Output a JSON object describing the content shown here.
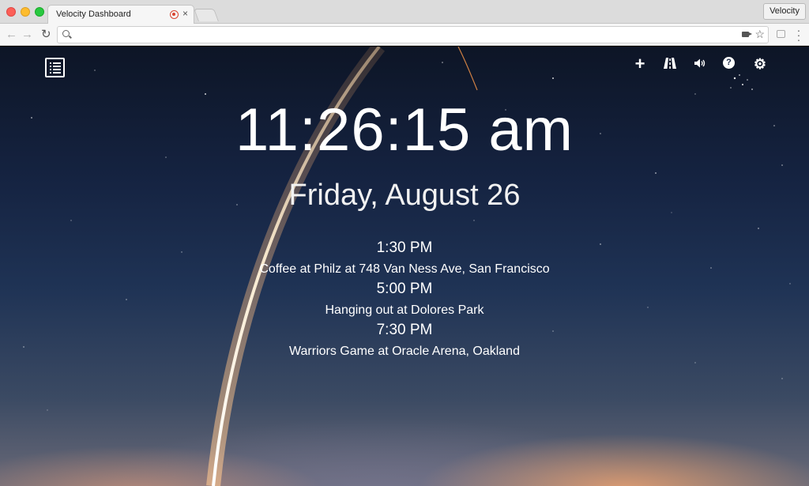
{
  "browser": {
    "tab_title": "Velocity Dashboard",
    "tab_close": "×",
    "profile_label": "Velocity",
    "address_value": ""
  },
  "icons": {
    "left": [
      "list-icon"
    ],
    "right": [
      "plus-icon",
      "road-icon",
      "volume-icon",
      "help-icon",
      "gear-icon"
    ],
    "plus_glyph": "+",
    "help_glyph": "?",
    "gear_glyph": "⚙"
  },
  "clock": {
    "time": "11:26:15 am",
    "date": "Friday, August 26"
  },
  "events": [
    {
      "time": "1:30 PM",
      "description": "Coffee at Philz at 748 Van Ness Ave, San Francisco"
    },
    {
      "time": "5:00 PM",
      "description": "Hanging out at Dolores Park"
    },
    {
      "time": "7:30 PM",
      "description": "Warriors Game at Oracle Arena, Oakland"
    }
  ],
  "colors": {
    "sky_top": "#0d1526",
    "sky_bottom": "#6a6a78",
    "text": "#ffffff"
  }
}
